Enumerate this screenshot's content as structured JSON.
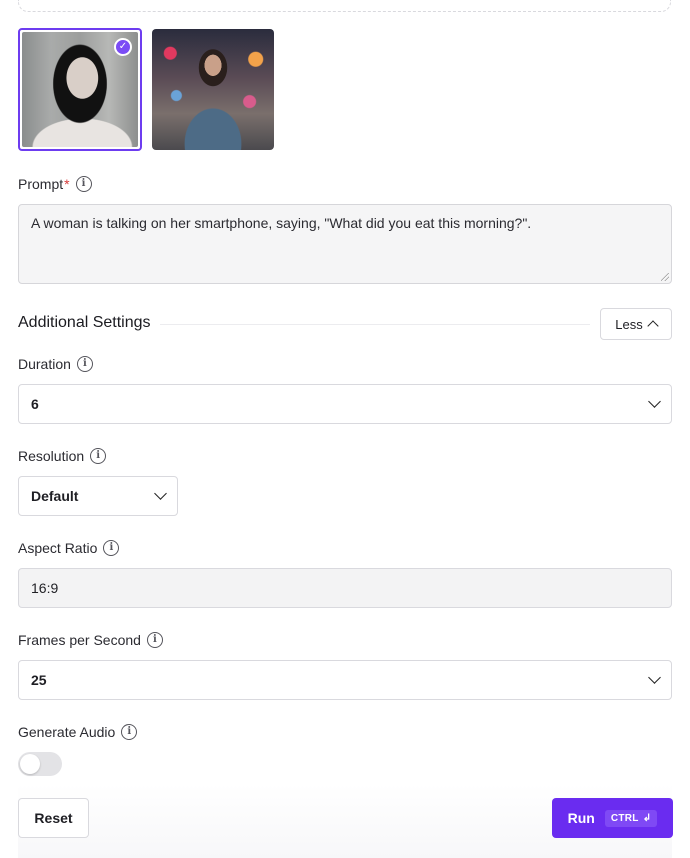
{
  "images": [
    {
      "name": "woman-on-phone",
      "selected": true
    },
    {
      "name": "woman-street",
      "selected": false
    }
  ],
  "prompt": {
    "label": "Prompt",
    "required_marker": "*",
    "value": "A woman is talking on her smartphone, saying, \"What did you eat this morning?\"."
  },
  "additional_settings": {
    "title": "Additional Settings",
    "toggle_label": "Less"
  },
  "duration": {
    "label": "Duration",
    "value": "6"
  },
  "resolution": {
    "label": "Resolution",
    "value": "Default"
  },
  "aspect_ratio": {
    "label": "Aspect Ratio",
    "value": "16:9"
  },
  "fps": {
    "label": "Frames per Second",
    "value": "25"
  },
  "generate_audio": {
    "label": "Generate Audio",
    "enabled": false
  },
  "actions": {
    "reset_label": "Reset",
    "run_label": "Run",
    "shortcut": "CTRL",
    "shortcut_icon": "↲"
  },
  "colors": {
    "accent": "#6a2cf0",
    "selected_border": "#6d3cf0",
    "required": "#d63b3b"
  }
}
